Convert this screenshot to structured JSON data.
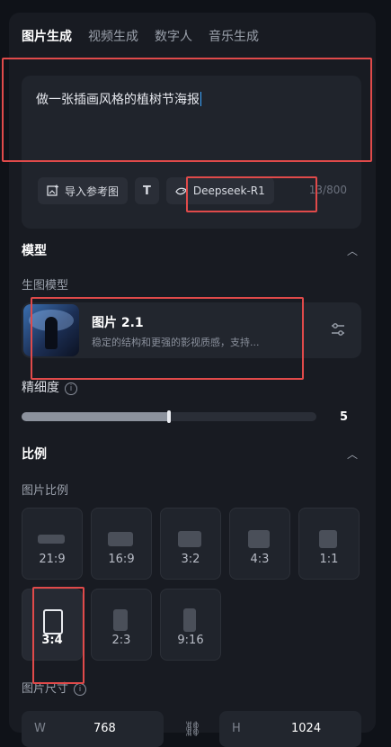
{
  "tabs": [
    {
      "label": "图片生成",
      "active": true
    },
    {
      "label": "视频生成"
    },
    {
      "label": "数字人"
    },
    {
      "label": "音乐生成"
    }
  ],
  "prompt": {
    "text": "做一张插画风格的植树节海报"
  },
  "tools": {
    "import_ref": "导入参考图",
    "text_icon": "T",
    "model_chip": "Deepseek-R1",
    "counter": "13/800"
  },
  "model_section": {
    "title": "模型",
    "sub_label": "生图模型",
    "card": {
      "name": "图片 2.1",
      "desc": "稳定的结构和更强的影视质感，支持..."
    }
  },
  "detail": {
    "label": "精细度",
    "value": "5",
    "level": 0.5
  },
  "ratio_section": {
    "title": "比例",
    "sub_label": "图片比例",
    "ratios": [
      {
        "label": "21:9"
      },
      {
        "label": "16:9"
      },
      {
        "label": "3:2"
      },
      {
        "label": "4:3"
      },
      {
        "label": "1:1"
      },
      {
        "label": "3:4",
        "selected": true
      },
      {
        "label": "2:3"
      },
      {
        "label": "9:16"
      }
    ]
  },
  "size": {
    "label": "图片尺寸",
    "w_prefix": "W",
    "w_value": "768",
    "h_prefix": "H",
    "h_value": "1024"
  },
  "colors": {
    "accent_red": "#e04a4a",
    "background": "#181b22",
    "caret": "#3aa6ff"
  }
}
